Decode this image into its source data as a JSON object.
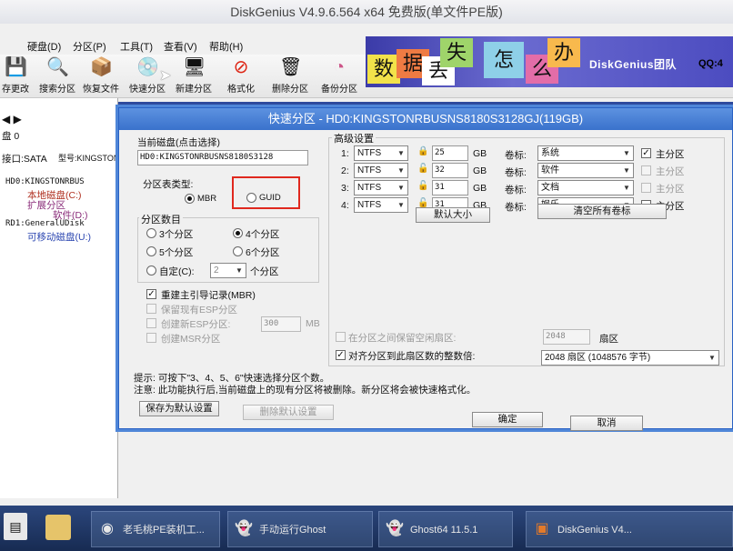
{
  "app": {
    "title": "DiskGenius V4.9.6.564 x64 免费版(单文件PE版)",
    "menu": [
      "硬盘(D)",
      "分区(P)",
      "工具(T)",
      "查看(V)",
      "帮助(H)"
    ],
    "toolbar": [
      {
        "label": "存更改",
        "icon": "save-icon",
        "glyph": "💾"
      },
      {
        "label": "搜索分区",
        "icon": "search-icon",
        "glyph": "🔍"
      },
      {
        "label": "恢复文件",
        "icon": "recover-icon",
        "glyph": "📦"
      },
      {
        "label": "快速分区",
        "icon": "disk-icon",
        "glyph": "💿"
      },
      {
        "label": "新建分区",
        "icon": "new-partition-icon",
        "glyph": "🖥"
      },
      {
        "label": "格式化",
        "icon": "format-icon",
        "glyph": "⊘"
      },
      {
        "label": "删除分区",
        "icon": "delete-icon",
        "glyph": "🗑"
      },
      {
        "label": "备份分区",
        "icon": "backup-icon",
        "glyph": "◔"
      }
    ],
    "banner": {
      "tiles": [
        "数",
        "据",
        "丢",
        "失",
        "怎",
        "么",
        "办"
      ],
      "brand": "DiskGenius团队",
      "qq": "QQ:4"
    },
    "left_pane": {
      "disk_label": "盘 0",
      "iface": "接口:SATA",
      "model": "型号:KINGSTONR",
      "tree": [
        "HD0:KINGSTONRBUS",
        "本地磁盘(C:)",
        "扩展分区",
        "软件(D:)",
        "RD1:GeneralUDisk",
        "可移动磁盘(U:)"
      ]
    },
    "colors": {
      "accent": "#3a72cc",
      "highlight": "#e0281e"
    }
  },
  "dialog": {
    "title": "快速分区 - HD0:KINGSTONRBUSNS8180S3128GJ(119GB)",
    "current_disk_label": "当前磁盘(点击选择)",
    "current_disk_value": "HD0:KINGSTONRBUSNS8180S3128",
    "table_type_label": "分区表类型:",
    "table_types": [
      "MBR",
      "GUID"
    ],
    "table_type_selected": "MBR",
    "count_label": "分区数目",
    "counts": [
      "3个分区",
      "4个分区",
      "5个分区",
      "6个分区",
      "自定(C):"
    ],
    "count_selected": "4个分区",
    "custom_value": "2",
    "custom_unit": "个分区",
    "rebuild_mbr": "重建主引导记录(MBR)",
    "keep_esp": "保留现有ESP分区",
    "create_esp": "创建新ESP分区:",
    "esp_size": "300",
    "esp_unit": "MB",
    "create_msr": "创建MSR分区",
    "advanced_label": "高级设置",
    "partitions": [
      {
        "index": "1:",
        "fs": "NTFS",
        "size": "25",
        "unit": "GB",
        "vol_label": "卷标:",
        "name": "系统",
        "primary": true
      },
      {
        "index": "2:",
        "fs": "NTFS",
        "size": "32",
        "unit": "GB",
        "vol_label": "卷标:",
        "name": "软件",
        "primary": false
      },
      {
        "index": "3:",
        "fs": "NTFS",
        "size": "31",
        "unit": "GB",
        "vol_label": "卷标:",
        "name": "文档",
        "primary": false
      },
      {
        "index": "4:",
        "fs": "NTFS",
        "size": "31",
        "unit": "GB",
        "vol_label": "卷标:",
        "name": "娱乐",
        "primary": false
      }
    ],
    "primary_label": "主分区",
    "default_size": "默认大小",
    "clear_labels": "清空所有卷标",
    "keep_gap": "在分区之间保留空闲扇区:",
    "gap_value": "2048",
    "gap_unit": "扇区",
    "align": "对齐分区到此扇区数的整数倍:",
    "align_value": "2048 扇区 (1048576 字节)",
    "hint1": "提示: 可按下\"3、4、5、6\"快速选择分区个数。",
    "hint2": "注意: 此功能执行后,当前磁盘上的现有分区将被删除。新分区将会被快速格式化。",
    "save_default": "保存为默认设置",
    "delete_default": "删除默认设置",
    "ok": "确定",
    "cancel": "取消"
  },
  "taskbar": {
    "items": [
      {
        "label": "老毛桃PE装机工...",
        "icon": "pe-tool-icon",
        "glyph": "◉"
      },
      {
        "label": "手动运行Ghost",
        "icon": "ghost-icon",
        "glyph": "👻"
      },
      {
        "label": "Ghost64 11.5.1",
        "icon": "ghost64-icon",
        "glyph": "👻"
      },
      {
        "label": "DiskGenius V4...",
        "icon": "diskgenius-icon",
        "glyph": "▣"
      }
    ]
  }
}
